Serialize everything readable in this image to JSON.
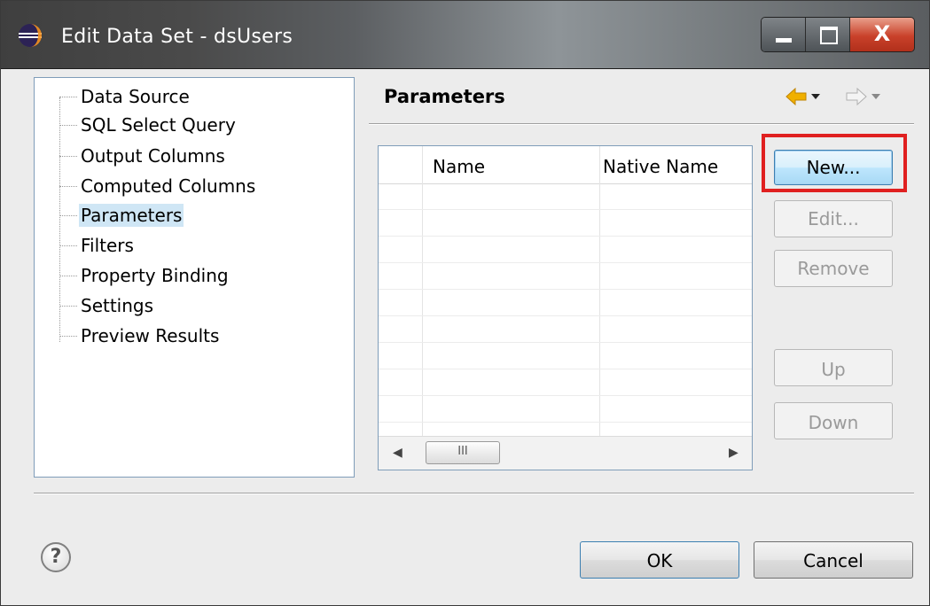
{
  "window": {
    "title": "Edit Data Set - dsUsers",
    "close_symbol": "X"
  },
  "tree": {
    "items": [
      {
        "label": "Data Source"
      },
      {
        "label": "SQL Select Query"
      },
      {
        "label": "Output Columns"
      },
      {
        "label": "Computed Columns"
      },
      {
        "label": "Parameters",
        "selected": true
      },
      {
        "label": "Filters"
      },
      {
        "label": "Property Binding"
      },
      {
        "label": "Settings"
      },
      {
        "label": "Preview Results"
      }
    ]
  },
  "page": {
    "title": "Parameters"
  },
  "parameters_table": {
    "columns": [
      "",
      "Name",
      "Native Name"
    ],
    "rows": [],
    "scroll_thumb_glyph": "III"
  },
  "buttons": {
    "new": "New...",
    "edit": "Edit...",
    "remove": "Remove",
    "up": "Up",
    "down": "Down",
    "ok": "OK",
    "cancel": "Cancel",
    "help": "?"
  },
  "icons": {
    "window": "eclipse-icon",
    "back": "back-arrow-icon",
    "forward": "forward-arrow-icon",
    "help": "help-icon"
  },
  "colors": {
    "highlight": "#e02020",
    "selection": "#cfe6f5",
    "back_arrow": "#f0b000"
  }
}
